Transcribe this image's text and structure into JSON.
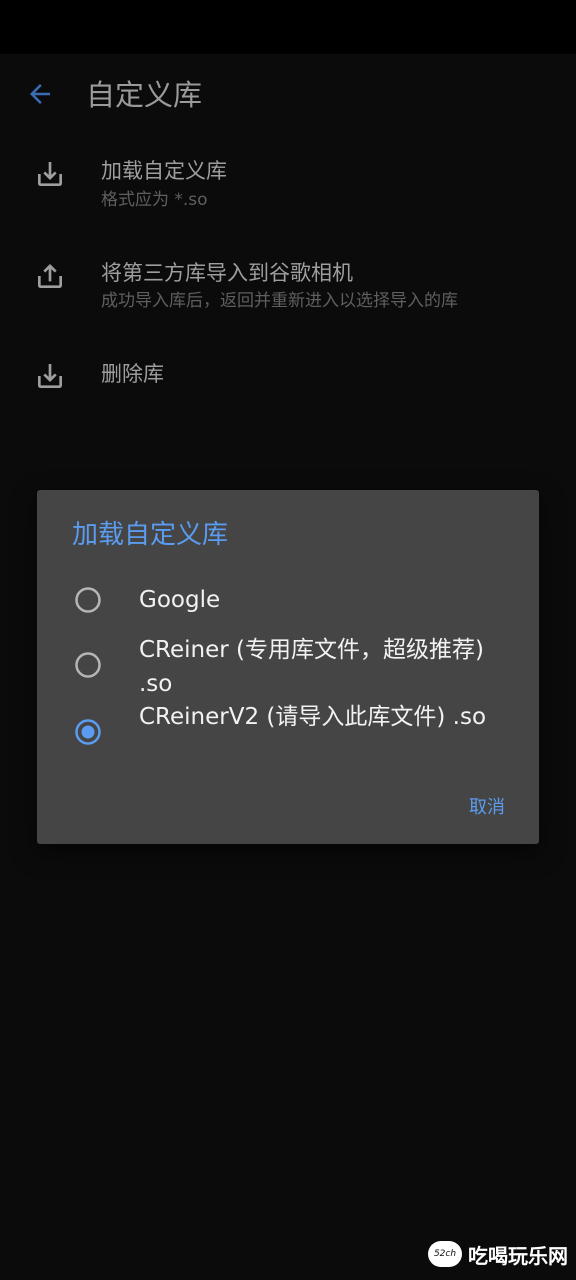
{
  "app_bar": {
    "title": "自定义库",
    "back_icon": "arrow-left-icon",
    "accent": "#3b6db4"
  },
  "preferences": [
    {
      "icon": "download-icon",
      "title": "加载自定义库",
      "summary": "格式应为 *.so"
    },
    {
      "icon": "upload-icon",
      "title": "将第三方库导入到谷歌相机",
      "summary": "成功导入库后，返回并重新进入以选择导入的库"
    },
    {
      "icon": "download-icon",
      "title": "删除库",
      "summary": ""
    }
  ],
  "dialog": {
    "title": "加载自定义库",
    "options": [
      {
        "label": "Google",
        "selected": false
      },
      {
        "label": "CReiner (专用库文件，超级推荐) .so",
        "selected": false
      },
      {
        "label": "CReinerV2 (请导入此库文件) .so",
        "selected": true
      }
    ],
    "cancel_label": "取消",
    "accent": "#5b9cf0"
  },
  "watermark": {
    "logo_text": "52ch",
    "text": "吃喝玩乐网"
  }
}
